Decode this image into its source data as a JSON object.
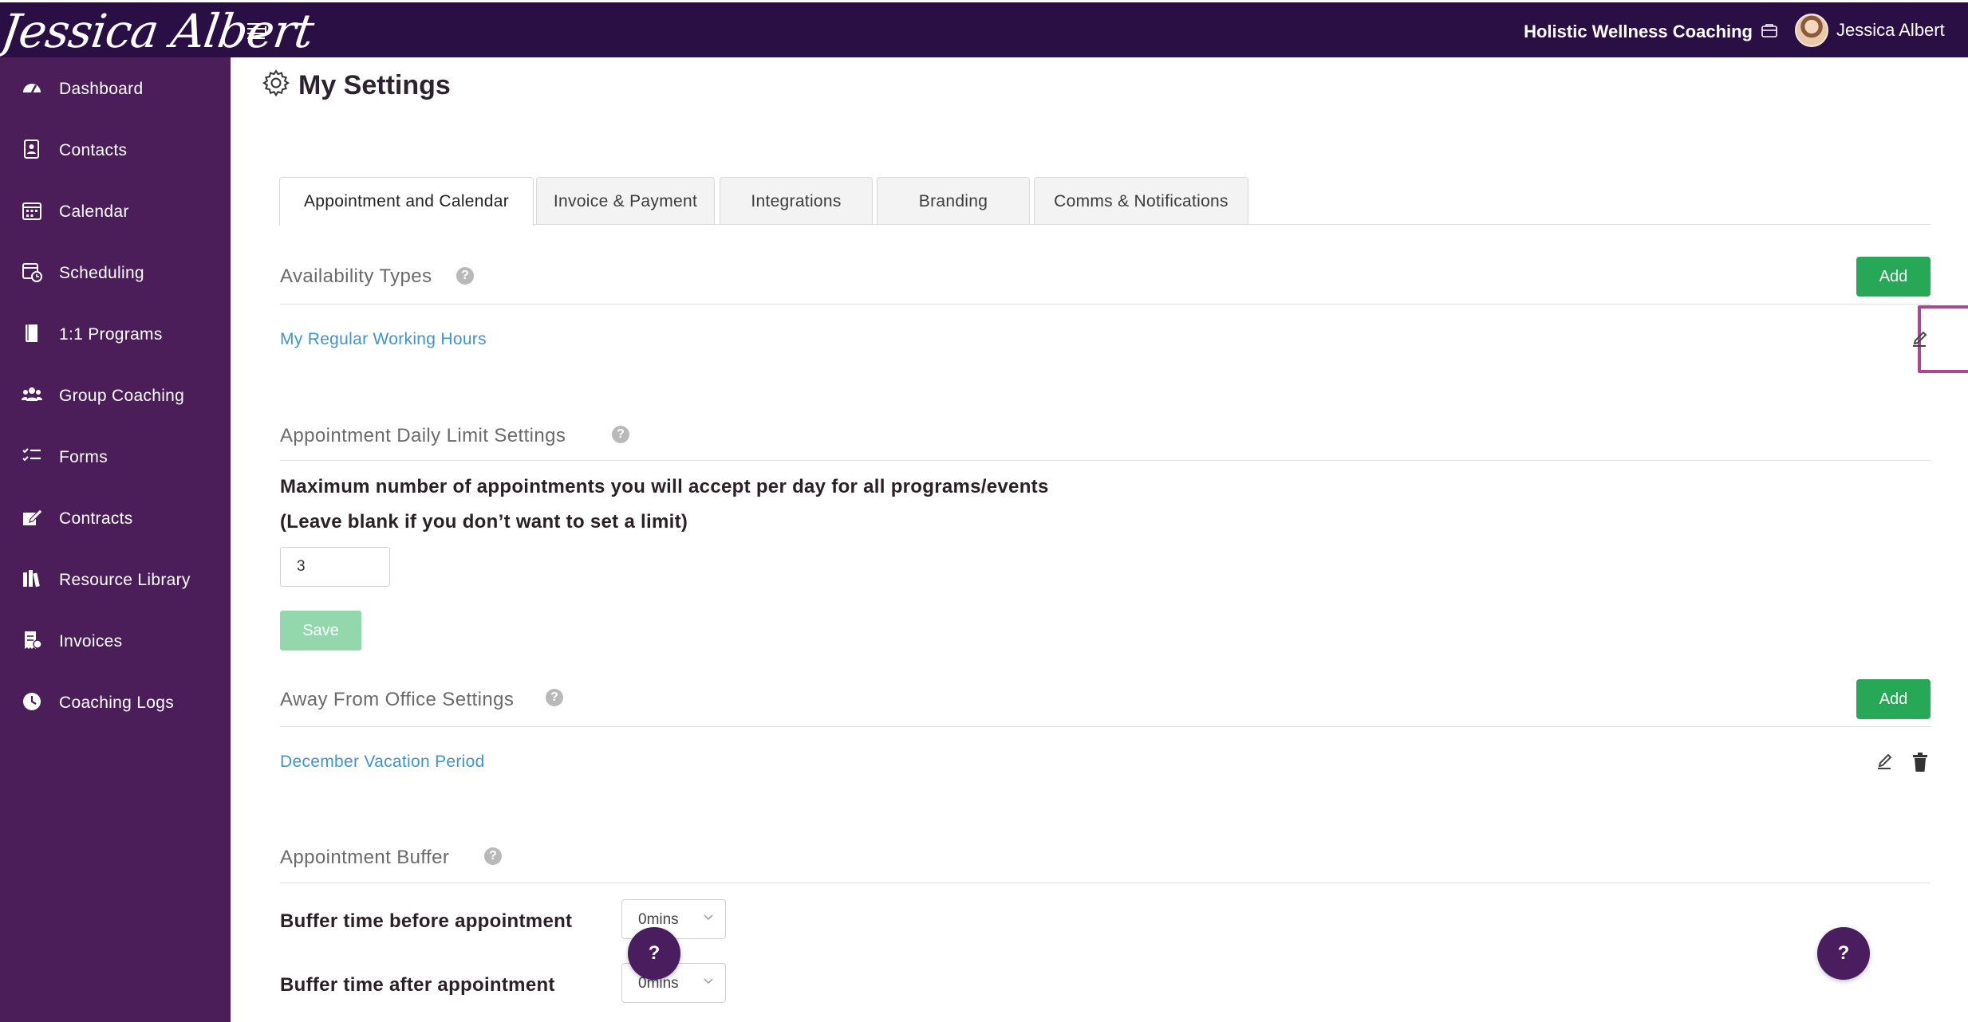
{
  "header": {
    "logo_text": "Jessica Albert",
    "org_name": "Holistic Wellness Coaching",
    "user_name": "Jessica Albert"
  },
  "sidebar": {
    "items": [
      {
        "label": "Dashboard",
        "icon": "dashboard-icon"
      },
      {
        "label": "Contacts",
        "icon": "contacts-icon"
      },
      {
        "label": "Calendar",
        "icon": "calendar-icon"
      },
      {
        "label": "Scheduling",
        "icon": "scheduling-icon"
      },
      {
        "label": "1:1 Programs",
        "icon": "book-icon"
      },
      {
        "label": "Group Coaching",
        "icon": "group-icon"
      },
      {
        "label": "Forms",
        "icon": "forms-icon"
      },
      {
        "label": "Contracts",
        "icon": "contract-icon"
      },
      {
        "label": "Resource Library",
        "icon": "library-icon"
      },
      {
        "label": "Invoices",
        "icon": "invoice-icon"
      },
      {
        "label": "Coaching Logs",
        "icon": "clock-icon"
      }
    ]
  },
  "page": {
    "title": "My Settings"
  },
  "tabs": [
    {
      "label": "Appointment and Calendar",
      "active": true
    },
    {
      "label": "Invoice & Payment",
      "active": false
    },
    {
      "label": "Integrations",
      "active": false
    },
    {
      "label": "Branding",
      "active": false
    },
    {
      "label": "Comms & Notifications",
      "active": false
    }
  ],
  "availability": {
    "title": "Availability Types",
    "add_label": "Add",
    "item": "My Regular Working Hours"
  },
  "daily_limit": {
    "title": "Appointment Daily Limit Settings",
    "line1": "Maximum number of appointments you will accept per day for all programs/events",
    "line2": "(Leave blank if you don’t want to set a limit)",
    "value": "3",
    "save_label": "Save"
  },
  "away": {
    "title": "Away From Office Settings",
    "add_label": "Add",
    "item": "December Vacation Period"
  },
  "buffer": {
    "title": "Appointment Buffer",
    "before_label": "Buffer time before appointment",
    "before_value": "0mins",
    "after_label": "Buffer time after appointment",
    "after_value": "0mins"
  },
  "help": {
    "fab_label": "?"
  },
  "colors": {
    "topbar": "#2a0f44",
    "sidebar": "#4b1e5a",
    "add_button": "#27a857",
    "save_button_disabled": "#93d7ad",
    "link": "#3d95cf",
    "highlight": "#a9488f"
  }
}
